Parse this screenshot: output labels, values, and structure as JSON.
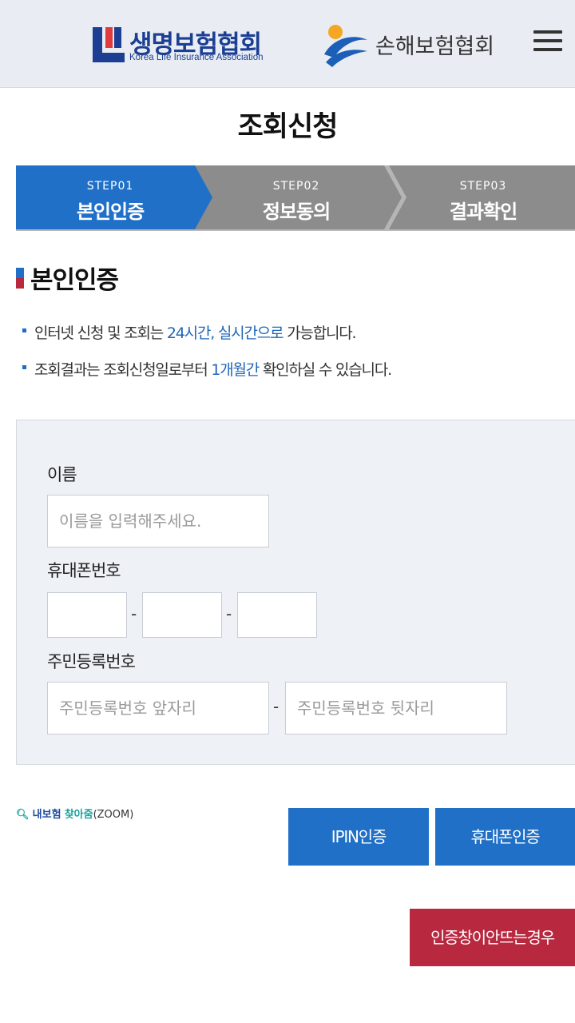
{
  "header": {
    "klia_name": "생명보험협회",
    "klia_sub": "Korea Life Insurance Association",
    "gia_name": "손해보험협회",
    "menu_icon": "hamburger-menu-icon"
  },
  "page_title": "조회신청",
  "steps": [
    {
      "num": "STEP01",
      "name": "본인인증",
      "active": true
    },
    {
      "num": "STEP02",
      "name": "정보동의",
      "active": false
    },
    {
      "num": "STEP03",
      "name": "결과확인",
      "active": false
    }
  ],
  "section_title": "본인인증",
  "notes": [
    {
      "pre": "인터넷 신청 및 조회는 ",
      "hl": "24시간, 실시간으로",
      "post": " 가능합니다."
    },
    {
      "pre": "조회결과는 조회신청일로부터 ",
      "hl": "1개월간",
      "post": " 확인하실 수 있습니다."
    }
  ],
  "form": {
    "name_label": "이름",
    "name_placeholder": "이름을 입력해주세요.",
    "phone_label": "휴대폰번호",
    "phone_sep": "-",
    "rrn_label": "주민등록번호",
    "rrn_front_placeholder": "주민등록번호 앞자리",
    "rrn_back_placeholder": "주민등록번호 뒷자리",
    "rrn_sep": "-"
  },
  "zoom_link": {
    "part1": "내보험",
    "part2": "찾아줌",
    "part3": "(ZOOM)"
  },
  "buttons": {
    "ipin": "IPIN인증",
    "phone": "휴대폰인증",
    "popup_help": "인증창이안뜨는경우"
  },
  "colors": {
    "active_step": "#2070c8",
    "inactive_step": "#8c8c8c",
    "accent_blue": "#1f66b6",
    "alert_red": "#b8283f"
  }
}
